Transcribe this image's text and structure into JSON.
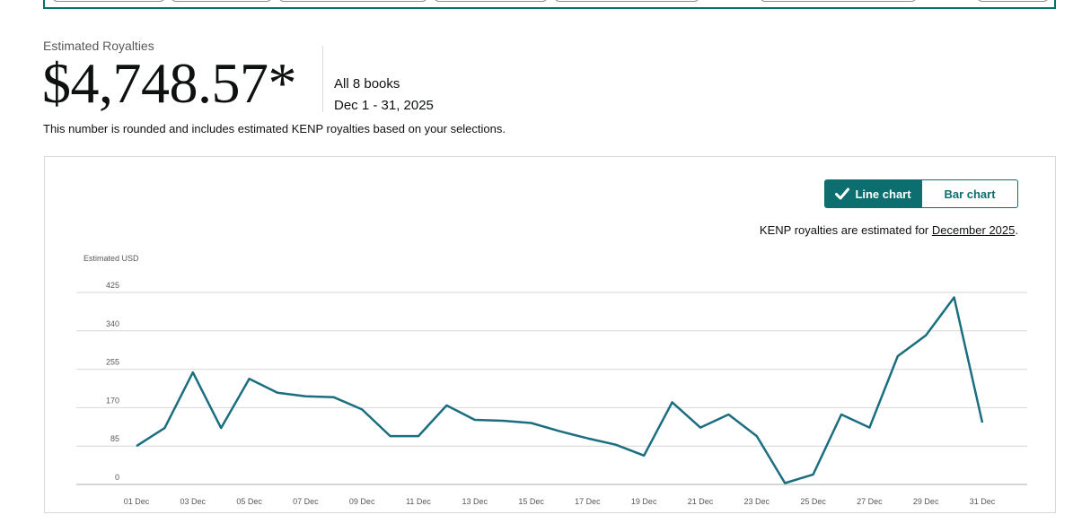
{
  "summary": {
    "label": "Estimated Royalties",
    "amount": "$4,748.57*",
    "scope": "All 8 books",
    "date_range": "Dec 1 - 31, 2025",
    "note": "This number is rounded and includes estimated KENP royalties based on your selections."
  },
  "chart_controls": {
    "line_chart_label": "Line chart",
    "bar_chart_label": "Bar chart",
    "selected": "Line chart"
  },
  "kenp_note": {
    "prefix": "KENP royalties are estimated for ",
    "link_text": "December 2025",
    "suffix": "."
  },
  "colors": {
    "accent": "#0d6e70",
    "line": "#1a6e80",
    "grid": "#d5d9d9"
  },
  "chart_data": {
    "type": "line",
    "ylabel": "Estimated USD",
    "ylim": [
      0,
      425
    ],
    "yticks": [
      0,
      85,
      170,
      255,
      340,
      425
    ],
    "grid": true,
    "x_tick_labels": [
      "01 Dec",
      "03 Dec",
      "05 Dec",
      "07 Dec",
      "09 Dec",
      "11 Dec",
      "13 Dec",
      "15 Dec",
      "17 Dec",
      "19 Dec",
      "21 Dec",
      "23 Dec",
      "25 Dec",
      "27 Dec",
      "29 Dec",
      "31 Dec"
    ],
    "x": [
      "01 Dec",
      "02 Dec",
      "03 Dec",
      "04 Dec",
      "05 Dec",
      "06 Dec",
      "07 Dec",
      "08 Dec",
      "09 Dec",
      "10 Dec",
      "11 Dec",
      "12 Dec",
      "13 Dec",
      "14 Dec",
      "15 Dec",
      "16 Dec",
      "17 Dec",
      "18 Dec",
      "19 Dec",
      "20 Dec",
      "21 Dec",
      "22 Dec",
      "23 Dec",
      "24 Dec",
      "25 Dec",
      "26 Dec",
      "27 Dec",
      "28 Dec",
      "29 Dec",
      "30 Dec",
      "31 Dec"
    ],
    "series": [
      {
        "values": [
          85,
          125,
          248,
          125,
          234,
          203,
          195,
          193,
          166,
          107,
          107,
          175,
          143,
          141,
          136,
          118,
          102,
          88,
          64,
          182,
          126,
          155,
          107,
          3,
          22,
          155,
          126,
          284,
          330,
          414,
          137
        ]
      }
    ]
  }
}
